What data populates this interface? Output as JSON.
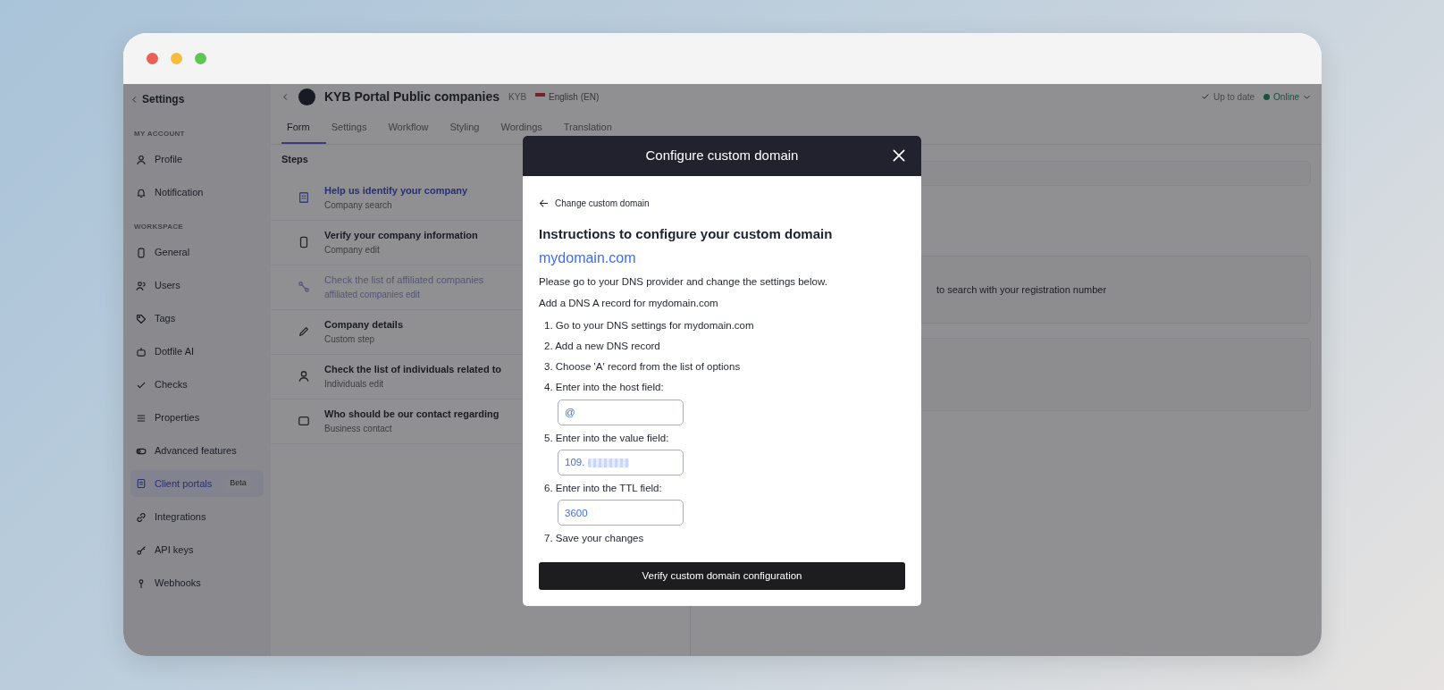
{
  "sidebar": {
    "back_label": "Settings",
    "sections": [
      {
        "heading": "MY ACCOUNT",
        "items": [
          {
            "label": "Profile",
            "selected": false
          },
          {
            "label": "Notification",
            "selected": false
          }
        ]
      },
      {
        "heading": "WORKSPACE",
        "items": [
          {
            "label": "General",
            "selected": false
          },
          {
            "label": "Users",
            "selected": false
          },
          {
            "label": "Tags",
            "selected": false
          },
          {
            "label": "Dotfile AI",
            "selected": false
          },
          {
            "label": "Checks",
            "selected": false
          },
          {
            "label": "Properties",
            "selected": false
          },
          {
            "label": "Advanced features",
            "selected": false
          },
          {
            "label": "Client portals",
            "badge": "Beta",
            "selected": true
          },
          {
            "label": "Integrations",
            "selected": false
          },
          {
            "label": "API keys",
            "selected": false
          },
          {
            "label": "Webhooks",
            "selected": false
          }
        ]
      }
    ]
  },
  "header": {
    "title": "KYB Portal Public companies",
    "tag": "KYB",
    "language": "English (EN)",
    "sync_status": "Up to date",
    "connection_status": "Online"
  },
  "tabs": [
    {
      "label": "Form",
      "selected": true
    },
    {
      "label": "Settings",
      "selected": false
    },
    {
      "label": "Workflow",
      "selected": false
    },
    {
      "label": "Styling",
      "selected": false
    },
    {
      "label": "Wordings",
      "selected": false
    },
    {
      "label": "Translation",
      "selected": false
    }
  ],
  "steps": {
    "heading": "Steps",
    "items": [
      {
        "title": "Help us identify your company",
        "subtitle": "Company search",
        "selected": true,
        "disabled": false
      },
      {
        "title": "Verify your company information",
        "subtitle": "Company edit",
        "selected": false,
        "disabled": false
      },
      {
        "title": "Check the list of affiliated companies",
        "subtitle": "affiliated companies edit",
        "selected": false,
        "disabled": true
      },
      {
        "title": "Company details",
        "subtitle": "Custom step",
        "selected": false,
        "disabled": false
      },
      {
        "title": "Check the list of individuals related to",
        "subtitle": "Individuals edit",
        "selected": false,
        "disabled": false
      },
      {
        "title": "Who should be our contact regarding",
        "subtitle": "Business contact",
        "selected": false,
        "disabled": false
      }
    ]
  },
  "right_panel": {
    "hint": "to search with your registration number"
  },
  "modal": {
    "title": "Configure custom domain",
    "back_link": "Change custom domain",
    "heading": "Instructions to configure your custom domain",
    "domain": "mydomain.com",
    "intro": "Please go to your DNS provider and change the settings below.",
    "record_line": "Add a DNS A record for mydomain.com",
    "instructions": [
      {
        "number": "1.",
        "text": "Go to your DNS settings for mydomain.com"
      },
      {
        "number": "2.",
        "text": "Add a new DNS record"
      },
      {
        "number": "3.",
        "text": "Choose 'A' record from the list of options"
      },
      {
        "number": "4.",
        "text": "Enter into the host field:",
        "field": {
          "value": "@"
        }
      },
      {
        "number": "5.",
        "text": "Enter into the value field:",
        "field": {
          "value": "109.",
          "redacted": true
        }
      },
      {
        "number": "6.",
        "text": "Enter into the TTL field:",
        "field": {
          "value": "3600"
        }
      },
      {
        "number": "7.",
        "text": "Save your changes"
      }
    ],
    "button": "Verify custom domain configuration"
  }
}
